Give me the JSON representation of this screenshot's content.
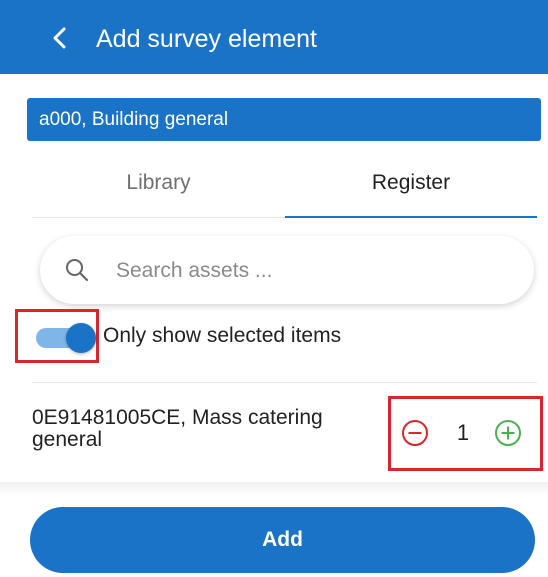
{
  "header": {
    "back_icon": "chevron-left-icon",
    "title": "Add survey element"
  },
  "context": {
    "label": "a000, Building general"
  },
  "tabs": [
    {
      "label": "Library",
      "active": false
    },
    {
      "label": "Register",
      "active": true
    }
  ],
  "search": {
    "icon": "search-icon",
    "placeholder": "Search assets ...",
    "value": ""
  },
  "filter": {
    "toggle_on": true,
    "label": "Only show selected items"
  },
  "items": [
    {
      "label": "0E91481005CE, Mass catering general",
      "quantity": "1",
      "minus_icon": "minus-circle-icon",
      "plus_icon": "plus-circle-icon"
    }
  ],
  "footer": {
    "add_label": "Add"
  },
  "colors": {
    "primary": "#1a73c6",
    "toggle_track": "#7fb6e8",
    "minus": "#d9262c",
    "plus": "#4caf50",
    "highlight": "#d9262c"
  }
}
